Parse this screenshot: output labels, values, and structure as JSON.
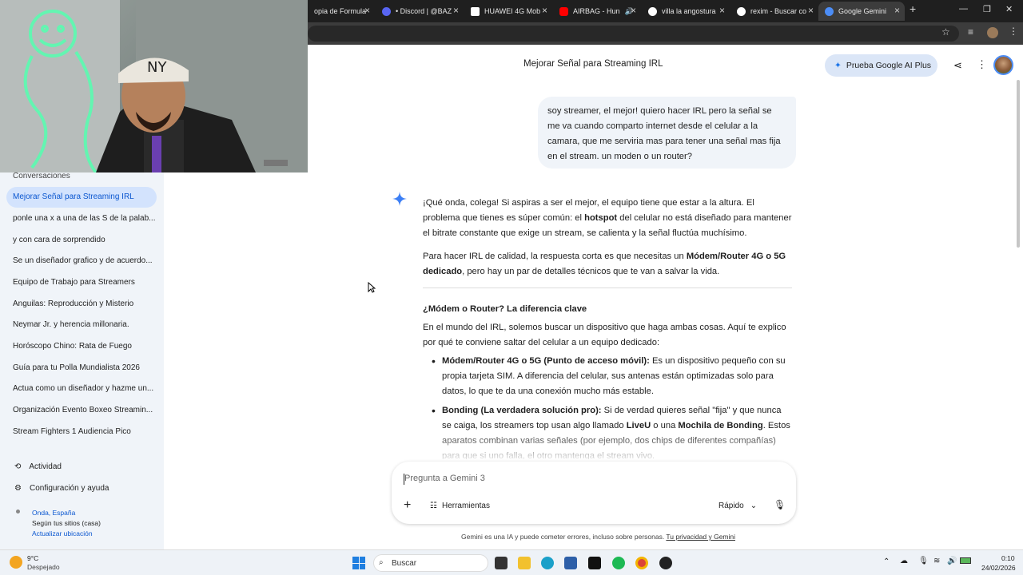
{
  "tabs": [
    {
      "label": "opia de Formula",
      "color": "#666"
    },
    {
      "label": "• Discord | @BAZ",
      "color": "#5865f2"
    },
    {
      "label": "HUAWEI 4G Mob",
      "color": "#ffffff"
    },
    {
      "label": "AIRBAG - Hun",
      "color": "#ff0000"
    },
    {
      "label": "villa la angostura",
      "color": "#ffffff"
    },
    {
      "label": "rexim - Buscar co",
      "color": "#ffffff"
    },
    {
      "label": "Google Gemini",
      "color": "#4c8df6"
    }
  ],
  "header": {
    "title": "Mejorar Señal para Streaming IRL",
    "upgrade_label": "Prueba Google AI Plus"
  },
  "sidebar": {
    "heading": "Conversaciones",
    "items": [
      "Mejorar Señal para Streaming IRL",
      "ponle una x a una de las S de la palab...",
      "y con cara de sorprendido",
      "Se un diseñador grafico y de acuerdo...",
      "Equipo de Trabajo para Streamers",
      "Anguilas: Reproducción y Misterio",
      "Neymar Jr. y herencia millonaria.",
      "Horóscopo Chino: Rata de Fuego",
      "Guía para tu Polla Mundialista 2026",
      "Actua como un diseñador y hazme un...",
      "Organización Evento Boxeo Streamin...",
      "Stream Fighters 1 Audiencia Pico"
    ],
    "activity": "Actividad",
    "settings": "Configuración y ayuda",
    "location_city": "Onda, España",
    "location_source": "Según tus sitios (casa)",
    "location_update": "Actualizar ubicación"
  },
  "chat": {
    "user_message": "soy streamer, el mejor! quiero hacer IRL pero la señal se me va cuando comparto internet desde el celular a la camara, que me serviria mas para tener una señal mas fija en el stream. un moden o un router?",
    "p1_a": "¡Qué onda, colega! Si aspiras a ser el mejor, el equipo tiene que estar a la altura. El problema que tienes es súper común: el ",
    "p1_b": "hotspot",
    "p1_c": " del celular no está diseñado para mantener el bitrate constante que exige un stream, se calienta y la señal fluctúa muchísimo.",
    "p2_a": "Para hacer IRL de calidad, la respuesta corta es que necesitas un ",
    "p2_b": "Módem/Router 4G o 5G dedicado",
    "p2_c": ", pero hay un par de detalles técnicos que te van a salvar la vida.",
    "heading": "¿Módem o Router? La diferencia clave",
    "p3": "En el mundo del IRL, solemos buscar un dispositivo que haga ambas cosas. Aquí te explico por qué te conviene saltar del celular a un equipo dedicado:",
    "b1_title": "Módem/Router 4G o 5G (Punto de acceso móvil):",
    "b1_text": " Es un dispositivo pequeño con su propia tarjeta SIM. A diferencia del celular, sus antenas están optimizadas solo para datos, lo que te da una conexión mucho más estable.",
    "b2_title": "Bonding (La verdadera solución pro):",
    "b2_a": " Si de verdad quieres señal \"fija\" y que nunca se caiga, los streamers top usan algo llamado ",
    "b2_b": "LiveU",
    "b2_c": " o una ",
    "b2_d": "Mochila de Bonding",
    "b2_e": ". Estos aparatos combinan varias señales (por ejemplo, dos chips de diferentes compañías) para que si uno falla, el otro mantenga el stream vivo."
  },
  "composer": {
    "placeholder": "Pregunta a Gemini 3",
    "tools": "Herramientas",
    "mode": "Rápido"
  },
  "disclaimer": {
    "text": "Gemini es una IA y puede cometer errores, incluso sobre personas. ",
    "link": "Tu privacidad y Gemini"
  },
  "taskbar": {
    "temp": "9°C",
    "weather": "Despejado",
    "search": "Buscar",
    "time": "0:10",
    "date": "24/02/2026"
  }
}
